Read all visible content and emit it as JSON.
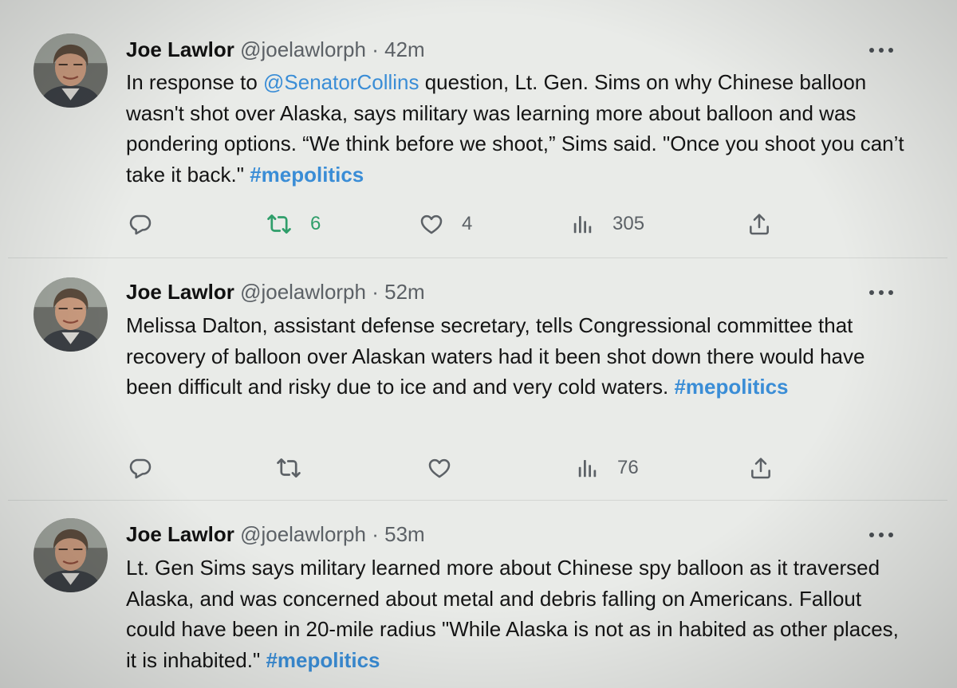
{
  "colors": {
    "mention": "#3a8dd6",
    "hashtag": "#3a8dd6",
    "retweet_active": "#2f9e6a",
    "secondary_text": "#5c6166"
  },
  "tweets": [
    {
      "author_name": "Joe Lawlor",
      "handle": "@joelawlorph",
      "separator": "·",
      "time": "42m",
      "text_before": "In response to ",
      "mention": "@SenatorCollins",
      "text_after": " question, Lt. Gen. Sims on why Chinese balloon wasn't shot over Alaska, says military was learning more about balloon and was pondering options. “We think before we shoot,” Sims said. \"Once you shoot you can’t take it back.\" ",
      "hashtag": "#mepolitics",
      "replies": "",
      "retweets": "6",
      "likes": "4",
      "views": "305"
    },
    {
      "author_name": "Joe Lawlor",
      "handle": "@joelawlorph",
      "separator": "·",
      "time": "52m",
      "text_before": "Melissa Dalton, assistant defense secretary, tells Congressional committee that recovery of balloon over Alaskan waters had it been shot down there would have been difficult and risky due to ice and and very cold waters. ",
      "hashtag": "#mepolitics",
      "replies": "",
      "retweets": "",
      "likes": "",
      "views": "76"
    },
    {
      "author_name": "Joe Lawlor",
      "handle": "@joelawlorph",
      "separator": "·",
      "time": "53m",
      "text_before": "Lt. Gen Sims says military learned more about Chinese spy balloon as it traversed Alaska, and was concerned about metal and debris falling on Americans. Fallout could have been in 20-mile radius \"While Alaska is not as in habited as other places, it is inhabited.\" ",
      "hashtag": "#mepolitics"
    }
  ],
  "icons": {
    "reply": "reply-icon",
    "retweet": "retweet-icon",
    "like": "heart-icon",
    "views": "views-icon",
    "share": "share-icon",
    "more": "more-icon"
  }
}
